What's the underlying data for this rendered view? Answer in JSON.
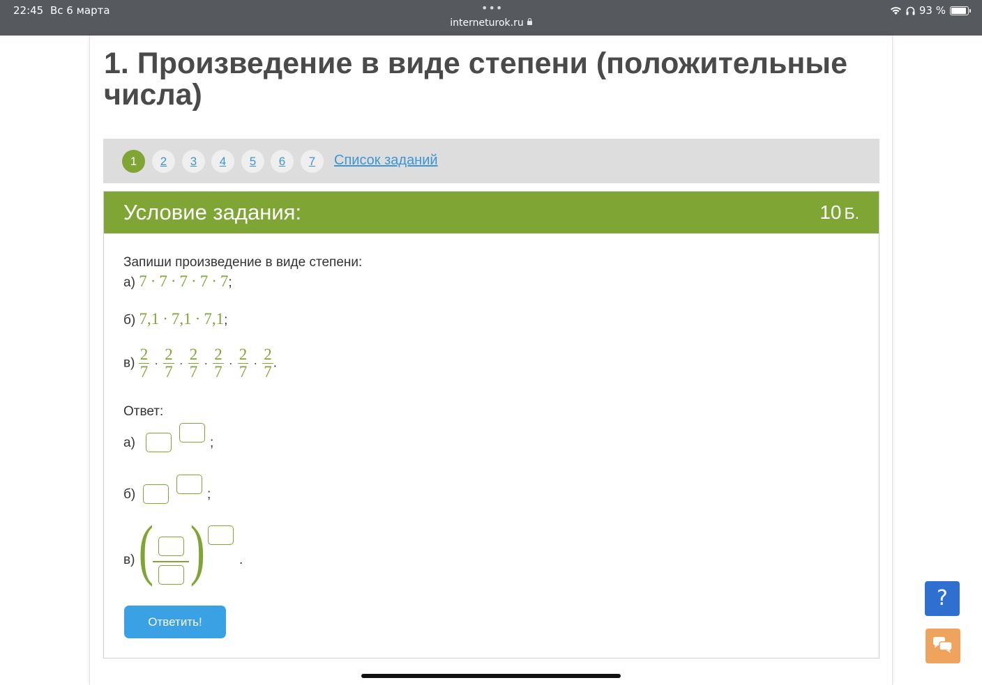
{
  "status_bar": {
    "time": "22:45",
    "date": "Вс 6 марта",
    "url": "interneturok.ru",
    "battery": "93 %",
    "battery_level": 0.93
  },
  "page": {
    "title": "1. Произведение в виде степени (положительные числа)"
  },
  "task_nav": {
    "items": [
      "1",
      "2",
      "3",
      "4",
      "5",
      "6",
      "7"
    ],
    "active": "1",
    "list_link": "Список заданий"
  },
  "task": {
    "header": "Условие задания:",
    "points": "10",
    "points_unit": "Б.",
    "prompt": "Запиши произведение в виде степени:",
    "a_label": "а)",
    "a_expr": [
      "7",
      "7",
      "7",
      "7",
      "7"
    ],
    "a_end": ";",
    "b_label": "б)",
    "b_expr": [
      "7,1",
      "7,1",
      "7,1"
    ],
    "b_end": ";",
    "c_label": "в)",
    "c_frac": {
      "num": "2",
      "den": "7",
      "count": 6
    },
    "c_end": ".",
    "dot": "·"
  },
  "answer": {
    "label": "Ответ:",
    "a_label": "а)",
    "a_end": ";",
    "b_label": "б)",
    "b_end": ";",
    "c_label": "в)",
    "c_end": "."
  },
  "submit_label": "Ответить!",
  "help_label": "?",
  "colors": {
    "accent_green": "#7fa634",
    "link_blue": "#3a97d4",
    "button_blue": "#3aa1e5",
    "help_blue": "#2f6fd0",
    "chat_orange": "#f0a35c"
  },
  "icons": [
    "wifi-icon",
    "headphones-icon",
    "battery-icon",
    "lock-icon",
    "chat-icon",
    "help-icon"
  ]
}
